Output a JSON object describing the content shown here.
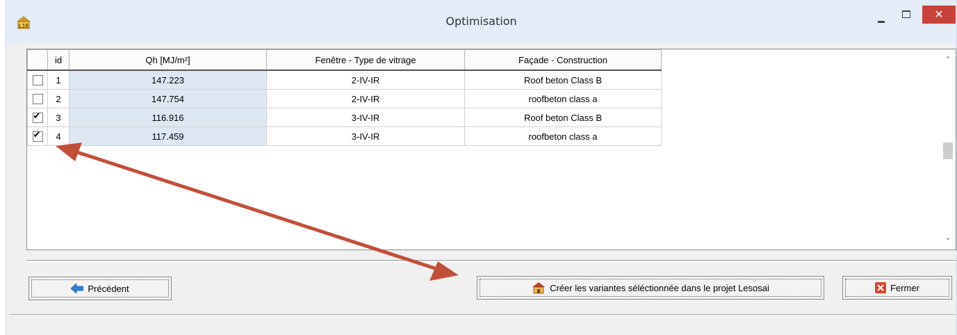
{
  "window": {
    "title": "Optimisation",
    "app_icon": "house-l18-icon",
    "close_glyph": "✕"
  },
  "grid": {
    "columns": [
      "id",
      "Qh [MJ/m²]",
      "Fenêtre - Type de vitrage",
      "Façade - Construction"
    ],
    "rows": [
      {
        "checked": false,
        "id": "1",
        "qh": "147.223",
        "fenetre": "2-IV-IR",
        "facade": "Roof beton Class B"
      },
      {
        "checked": false,
        "id": "2",
        "qh": "147.754",
        "fenetre": "2-IV-IR",
        "facade": "roofbeton class a"
      },
      {
        "checked": true,
        "id": "3",
        "qh": "116.916",
        "fenetre": "3-IV-IR",
        "facade": "Roof beton Class B"
      },
      {
        "checked": true,
        "id": "4",
        "qh": "117.459",
        "fenetre": "3-IV-IR",
        "facade": "roofbeton class a"
      }
    ]
  },
  "buttons": {
    "previous": "Précédent",
    "create": "Créer les variantes séléctionnée dans le projet Lesosai",
    "close": "Fermer"
  },
  "colors": {
    "annotation_arrow": "#c0503a",
    "selected_column": "#dde8f3",
    "close_button": "#c7423a"
  }
}
